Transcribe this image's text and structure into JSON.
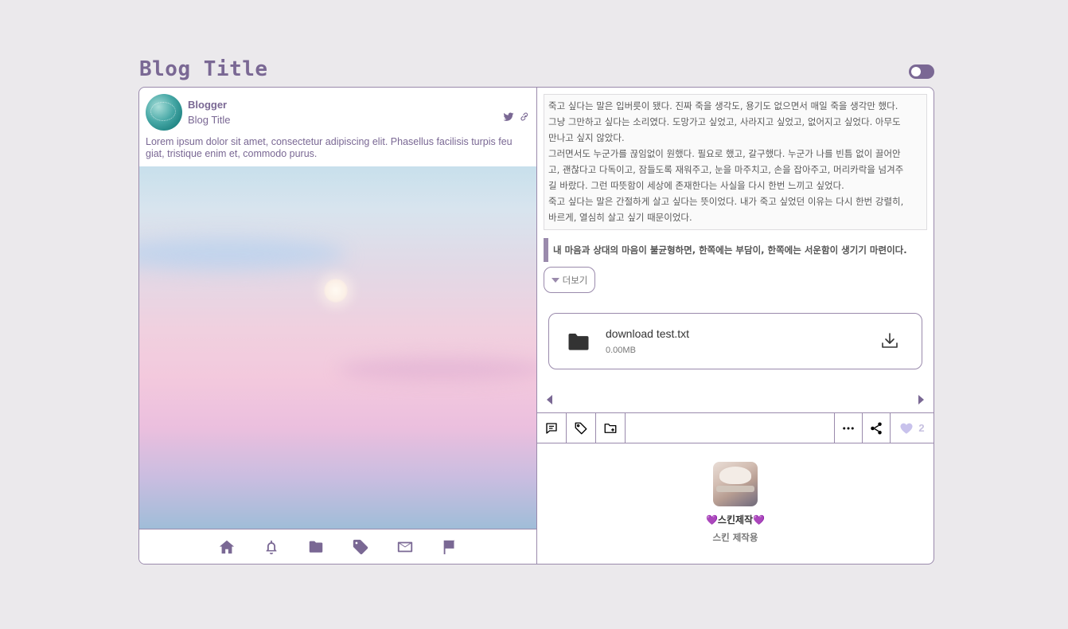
{
  "header": {
    "blog_title": "Blog Title",
    "theme_toggle_state": "on"
  },
  "profile": {
    "name": "Blogger",
    "subtitle": "Blog Title",
    "description": "Lorem ipsum dolor sit amet, consectetur adipiscing elit. Phasellus facilisis turpis feu giat, tristique enim et, commodo purus.",
    "social_icons": [
      "twitter-icon",
      "link-icon"
    ]
  },
  "nav": {
    "icons": [
      "home-icon",
      "bell-icon",
      "folder-icon",
      "tag-icon",
      "mail-icon",
      "flag-icon"
    ]
  },
  "post": {
    "paragraph_lines": [
      "죽고 싶다는 말은 입버릇이 됐다. 진짜 죽을 생각도, 용기도 없으면서 매일 죽을 생각만 했다.",
      "그냥 그만하고 싶다는 소리였다. 도망가고 싶었고, 사라지고 싶었고, 없어지고 싶었다. 아무도",
      "만나고 싶지 않았다.",
      "그러면서도 누군가를 끊임없이 원했다. 필요로 했고, 갈구했다. 누군가 나를 빈틈 없이 끌어안",
      "고, 괜찮다고 다독이고, 잠들도록 재워주고, 눈을 마주치고, 손을 잡아주고, 머리카락을 넘겨주",
      "길 바랐다. 그런 따뜻함이 세상에 존재한다는 사실을 다시 한번 느끼고 싶었다.",
      "죽고 싶다는 말은 간절하게 살고 싶다는 뜻이었다. 내가 죽고 싶었던 이유는 다시 한번 강렬히,",
      "바르게, 열심히 살고 싶기 때문이었다."
    ],
    "quote": "내 마음과 상대의 마음이 불균형하면, 한쪽에는 부담이, 한쪽에는 서운함이 생기기 마련이다.",
    "more_label": "더보기"
  },
  "file": {
    "name": "download test.txt",
    "size": "0.00MB"
  },
  "toolbar": {
    "icons": [
      "comment-icon",
      "tag-icon",
      "folder-add-icon",
      "more-icon",
      "share-icon",
      "heart-icon"
    ],
    "like_count": "2"
  },
  "author": {
    "name": "스킨제작",
    "heart_left": "💜",
    "heart_right": "💜",
    "subtitle": "스킨 제작용"
  },
  "colors": {
    "accent": "#7a6894",
    "border": "#9a8aac",
    "background": "#ebe9ec",
    "like": "#c8c2ec"
  }
}
